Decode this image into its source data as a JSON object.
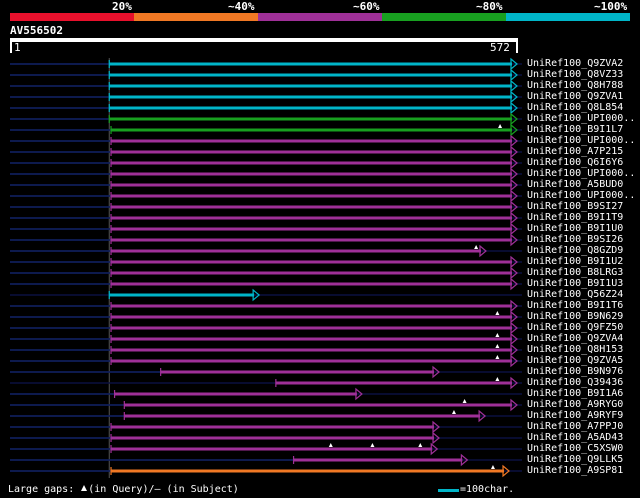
{
  "colors": {
    "background": "#000000",
    "text": "#ffffff",
    "track": "#0b1040",
    "gridline": "#555555",
    "identity_bands": [
      "#e8102c",
      "#f07824",
      "#9f3098",
      "#18a020",
      "#00b5c8"
    ]
  },
  "scale": {
    "labels": [
      "20%",
      "~40%",
      "~60%",
      "~80%",
      "~100%"
    ]
  },
  "query": {
    "title": "AV556502",
    "start_label": "1",
    "end_label": "572",
    "length": 572
  },
  "chart_data": {
    "type": "alignment-overview",
    "query_range": [
      1,
      572
    ],
    "hits": [
      {
        "label": "UniRef100_Q9ZVA2",
        "identity_band": 4,
        "q_start": 113,
        "q_end": 572,
        "left_gap_start": 1,
        "marks": []
      },
      {
        "label": "UniRef100_Q8VZ33",
        "identity_band": 4,
        "q_start": 113,
        "q_end": 572,
        "left_gap_start": 1,
        "marks": []
      },
      {
        "label": "UniRef100_Q8H788",
        "identity_band": 4,
        "q_start": 113,
        "q_end": 572,
        "left_gap_start": 1,
        "marks": []
      },
      {
        "label": "UniRef100_Q9ZVA1",
        "identity_band": 4,
        "q_start": 113,
        "q_end": 572,
        "left_gap_start": 1,
        "marks": []
      },
      {
        "label": "UniRef100_Q8L854",
        "identity_band": 4,
        "q_start": 113,
        "q_end": 572,
        "left_gap_start": 1,
        "marks": []
      },
      {
        "label": "UniRef100_UPI000..",
        "identity_band": 3,
        "q_start": 113,
        "q_end": 572,
        "left_gap_start": 1,
        "marks": []
      },
      {
        "label": "UniRef100_B9I1L7",
        "identity_band": 3,
        "q_start": 115,
        "q_end": 572,
        "left_gap_start": 1,
        "marks": [
          554
        ]
      },
      {
        "label": "UniRef100_UPI000..",
        "identity_band": 2,
        "q_start": 115,
        "q_end": 572,
        "left_gap_start": 1,
        "marks": []
      },
      {
        "label": "UniRef100_A7P215",
        "identity_band": 2,
        "q_start": 115,
        "q_end": 572,
        "left_gap_start": 1,
        "marks": []
      },
      {
        "label": "UniRef100_Q6I6Y6",
        "identity_band": 2,
        "q_start": 115,
        "q_end": 572,
        "left_gap_start": 1,
        "marks": []
      },
      {
        "label": "UniRef100_UPI000..",
        "identity_band": 2,
        "q_start": 115,
        "q_end": 572,
        "left_gap_start": 1,
        "marks": []
      },
      {
        "label": "UniRef100_A5BUD0",
        "identity_band": 2,
        "q_start": 115,
        "q_end": 572,
        "left_gap_start": 1,
        "marks": []
      },
      {
        "label": "UniRef100_UPI000..",
        "identity_band": 2,
        "q_start": 115,
        "q_end": 572,
        "left_gap_start": 1,
        "marks": []
      },
      {
        "label": "UniRef100_B9SI27",
        "identity_band": 2,
        "q_start": 115,
        "q_end": 572,
        "left_gap_start": 1,
        "marks": []
      },
      {
        "label": "UniRef100_B9I1T9",
        "identity_band": 2,
        "q_start": 115,
        "q_end": 572,
        "left_gap_start": 1,
        "marks": []
      },
      {
        "label": "UniRef100_B9I1U0",
        "identity_band": 2,
        "q_start": 115,
        "q_end": 572,
        "left_gap_start": 1,
        "marks": []
      },
      {
        "label": "UniRef100_B9SI26",
        "identity_band": 2,
        "q_start": 115,
        "q_end": 572,
        "left_gap_start": 1,
        "marks": []
      },
      {
        "label": "UniRef100_Q8GZD9",
        "identity_band": 2,
        "q_start": 115,
        "q_end": 537,
        "left_gap_start": 1,
        "marks": [
          527
        ]
      },
      {
        "label": "UniRef100_B9I1U2",
        "identity_band": 2,
        "q_start": 115,
        "q_end": 572,
        "left_gap_start": 1,
        "marks": []
      },
      {
        "label": "UniRef100_B8LRG3",
        "identity_band": 2,
        "q_start": 115,
        "q_end": 572,
        "left_gap_start": 1,
        "marks": []
      },
      {
        "label": "UniRef100_B9I1U3",
        "identity_band": 2,
        "q_start": 115,
        "q_end": 572,
        "left_gap_start": 1,
        "marks": []
      },
      {
        "label": "UniRef100_Q56Z24",
        "identity_band": 4,
        "q_start": 113,
        "q_end": 281,
        "left_gap_start": null,
        "marks": []
      },
      {
        "label": "UniRef100_B9I1T6",
        "identity_band": 2,
        "q_start": 115,
        "q_end": 572,
        "left_gap_start": 1,
        "marks": []
      },
      {
        "label": "UniRef100_B9N629",
        "identity_band": 2,
        "q_start": 115,
        "q_end": 572,
        "left_gap_start": 1,
        "marks": [
          551
        ]
      },
      {
        "label": "UniRef100_Q9FZ50",
        "identity_band": 2,
        "q_start": 115,
        "q_end": 572,
        "left_gap_start": 1,
        "marks": []
      },
      {
        "label": "UniRef100_Q9ZVA4",
        "identity_band": 2,
        "q_start": 115,
        "q_end": 572,
        "left_gap_start": 1,
        "marks": [
          551
        ]
      },
      {
        "label": "UniRef100_Q8H153",
        "identity_band": 2,
        "q_start": 115,
        "q_end": 572,
        "left_gap_start": 1,
        "marks": [
          551
        ]
      },
      {
        "label": "UniRef100_Q9ZVA5",
        "identity_band": 2,
        "q_start": 115,
        "q_end": 572,
        "left_gap_start": 1,
        "marks": [
          551
        ]
      },
      {
        "label": "UniRef100_B9N976",
        "identity_band": 2,
        "q_start": 171,
        "q_end": 484,
        "left_gap_start": 1,
        "marks": []
      },
      {
        "label": "UniRef100_Q39436",
        "identity_band": 2,
        "q_start": 301,
        "q_end": 572,
        "left_gap_start": null,
        "marks": [
          551
        ]
      },
      {
        "label": "UniRef100_B9I1A6",
        "identity_band": 2,
        "q_start": 119,
        "q_end": 397,
        "left_gap_start": 1,
        "marks": []
      },
      {
        "label": "UniRef100_A9RYG0",
        "identity_band": 2,
        "q_start": 130,
        "q_end": 572,
        "left_gap_start": 1,
        "marks": [
          514
        ]
      },
      {
        "label": "UniRef100_A9RYF9",
        "identity_band": 2,
        "q_start": 130,
        "q_end": 536,
        "left_gap_start": 1,
        "marks": [
          502
        ]
      },
      {
        "label": "UniRef100_A7PPJ0",
        "identity_band": 2,
        "q_start": 115,
        "q_end": 484,
        "left_gap_start": 1,
        "marks": []
      },
      {
        "label": "UniRef100_A5AD43",
        "identity_band": 2,
        "q_start": 115,
        "q_end": 484,
        "left_gap_start": 1,
        "marks": []
      },
      {
        "label": "UniRef100_C5XSW0",
        "identity_band": 2,
        "q_start": 115,
        "q_end": 482,
        "left_gap_start": 1,
        "marks": [
          363,
          410,
          464
        ]
      },
      {
        "label": "UniRef100_Q9LLK5",
        "identity_band": 2,
        "q_start": 321,
        "q_end": 516,
        "left_gap_start": 1,
        "marks": []
      },
      {
        "label": "UniRef100_A9SP81",
        "identity_band": 1,
        "q_start": 115,
        "q_end": 563,
        "left_gap_start": 1,
        "marks": [
          546
        ]
      }
    ]
  },
  "footer": {
    "large_gaps_prefix": "Large gaps:",
    "large_gaps_query": "(in Query)/",
    "large_gaps_dash": "–",
    "large_gaps_subject": " (in Subject)",
    "scale_text": "=100char."
  }
}
